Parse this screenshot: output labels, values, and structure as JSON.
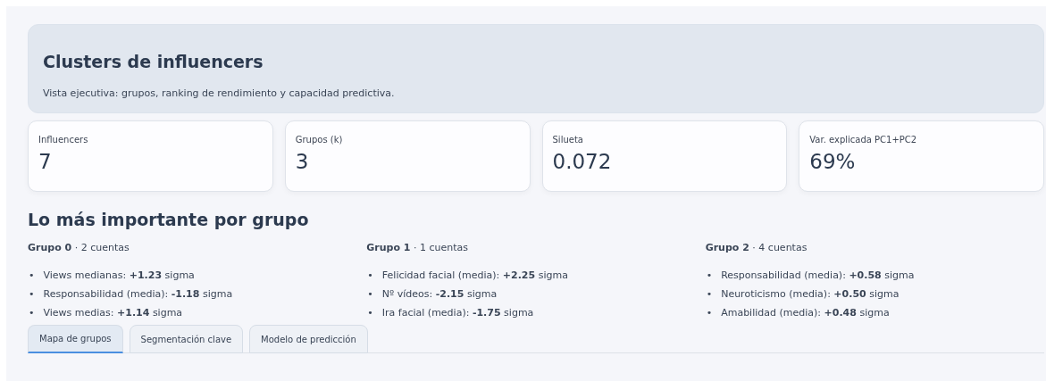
{
  "header": {
    "title": "Clusters de influencers",
    "subtitle": "Vista ejecutiva: grupos, ranking de rendimiento y capacidad predictiva."
  },
  "metrics": [
    {
      "label": "Influencers",
      "value": "7"
    },
    {
      "label": "Grupos (k)",
      "value": "3"
    },
    {
      "label": "Silueta",
      "value": "0.072"
    },
    {
      "label": "Var. explicada PC1+PC2",
      "value": "69%"
    }
  ],
  "section_title": "Lo más importante por grupo",
  "groups": [
    {
      "heading": "**Grupo 0** · 2 cuentas",
      "items": [
        {
          "bullet": "•",
          "text": "Views medianas: **+1.23** sigma"
        },
        {
          "bullet": "•",
          "text": "Responsabilidad (media): **-1.18** sigma"
        },
        {
          "bullet": "•",
          "text": "Views medias: **+1.14** sigma"
        }
      ]
    },
    {
      "heading": "**Grupo 1** · 1 cuentas",
      "items": [
        {
          "bullet": "•",
          "text": "Felicidad facial (media): **+2.25** sigma"
        },
        {
          "bullet": "•",
          "text": "Nº vídeos: **-2.15** sigma"
        },
        {
          "bullet": "•",
          "text": "Ira facial (media): **-1.75** sigma"
        }
      ]
    },
    {
      "heading": "**Grupo 2** · 4 cuentas",
      "items": [
        {
          "bullet": "•",
          "text": "Responsabilidad (media): **+0.58** sigma"
        },
        {
          "bullet": "•",
          "text": "Neuroticismo (media): **+0.50** sigma"
        },
        {
          "bullet": "•",
          "text": "Amabilidad (media): **+0.48** sigma"
        }
      ]
    }
  ],
  "tabs": [
    {
      "label": "Mapa de grupos",
      "selected": true
    },
    {
      "label": "Segmentación clave",
      "selected": false
    },
    {
      "label": "Modelo de predicción",
      "selected": false
    }
  ]
}
